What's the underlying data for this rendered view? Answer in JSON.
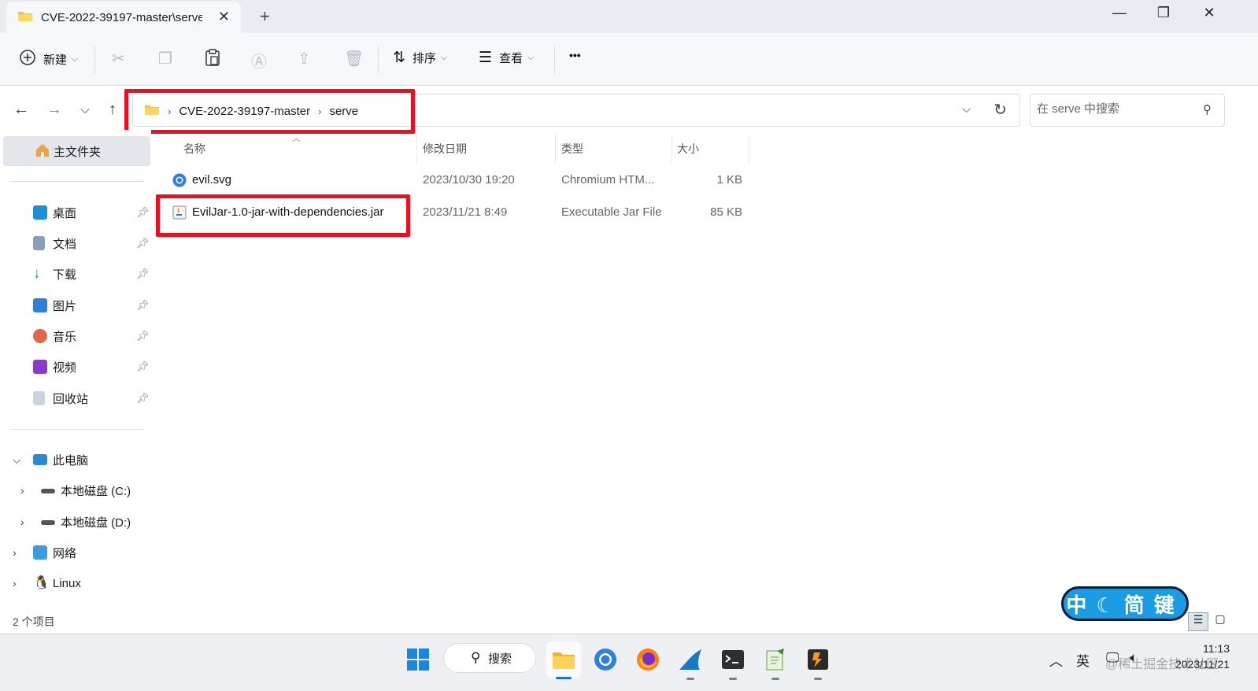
{
  "window": {
    "tab_title": "CVE-2022-39197-master\\serve",
    "tab_close": "✕",
    "new_tab": "+",
    "minimize": "—",
    "maximize": "❐",
    "close": "✕"
  },
  "toolbar": {
    "new_label": "新建",
    "sort_label": "排序",
    "view_label": "查看",
    "more_label": "•••"
  },
  "address": {
    "crumbs": [
      "CVE-2022-39197-master",
      "serve"
    ],
    "search_placeholder": "在 serve 中搜索"
  },
  "sidebar": {
    "home": "主文件夹",
    "quick_access": [
      {
        "label": "桌面",
        "icon": "desktop-icon",
        "color": "#1d8fd8"
      },
      {
        "label": "文档",
        "icon": "document-icon",
        "color": "#8aa0b8"
      },
      {
        "label": "下载",
        "icon": "download-icon",
        "color": "#1a9a5a"
      },
      {
        "label": "图片",
        "icon": "pictures-icon",
        "color": "#2f7fd6"
      },
      {
        "label": "音乐",
        "icon": "music-icon",
        "color": "#e0674a"
      },
      {
        "label": "视频",
        "icon": "video-icon",
        "color": "#8a3bc9"
      },
      {
        "label": "回收站",
        "icon": "recycle-bin-icon",
        "color": "#c9d3de"
      }
    ],
    "this_pc": "此电脑",
    "drive_c": "本地磁盘 (C:)",
    "drive_d": "本地磁盘 (D:)",
    "network": "网络",
    "linux": "Linux"
  },
  "columns": {
    "name": "名称",
    "modified": "修改日期",
    "type": "类型",
    "size": "大小"
  },
  "files": [
    {
      "name": "evil.svg",
      "modified": "2023/10/30 19:20",
      "type": "Chromium HTM...",
      "size": "1 KB",
      "icon": "chromium-file-icon"
    },
    {
      "name": "EvilJar-1.0-jar-with-dependencies.jar",
      "modified": "2023/11/21 8:49",
      "type": "Executable Jar File",
      "size": "85 KB",
      "icon": "java-jar-icon"
    }
  ],
  "status": {
    "item_count": "2 个项目"
  },
  "ime": {
    "text": "中☾简键"
  },
  "taskbar": {
    "search_label": "搜索",
    "lang": "英",
    "time": "11:13",
    "date": "2023/11/21"
  },
  "watermark": "@稀土掘金技术社区",
  "colors": {
    "highlight": "#e81123",
    "accent": "#1a73d9"
  }
}
